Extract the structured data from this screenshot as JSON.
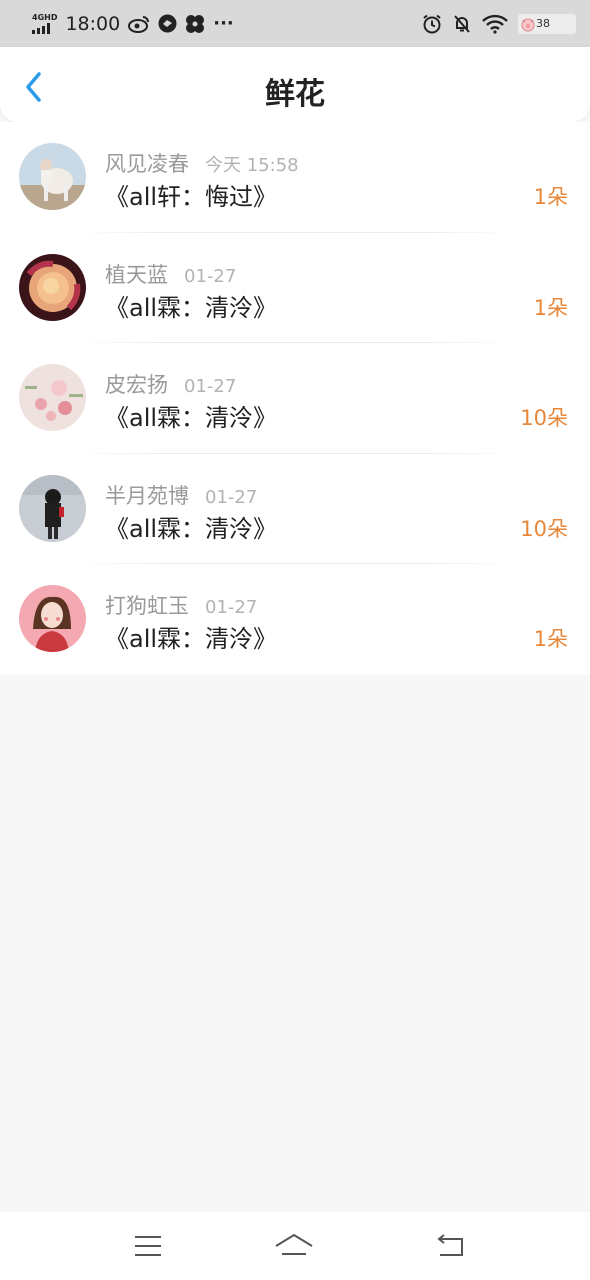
{
  "status_bar": {
    "network": "4GHD",
    "time": "18:00",
    "more": "···",
    "battery": "38"
  },
  "header": {
    "title": "鲜花"
  },
  "entries": [
    {
      "name": "风见凌春",
      "time": "今天 15:58",
      "work": "《all轩：悔过》",
      "count": "1朵"
    },
    {
      "name": "植天蓝",
      "time": "01-27",
      "work": "《all霖：清泠》",
      "count": "1朵"
    },
    {
      "name": "皮宏扬",
      "time": "01-27",
      "work": "《all霖：清泠》",
      "count": "10朵"
    },
    {
      "name": "半月苑博",
      "time": "01-27",
      "work": "《all霖：清泠》",
      "count": "10朵"
    },
    {
      "name": "打狗虹玉",
      "time": "01-27",
      "work": "《all霖：清泠》",
      "count": "1朵"
    }
  ],
  "colors": {
    "accent_blue": "#2a9be8",
    "count_orange": "#e8873a",
    "status_bar_bg": "#d9d9d9",
    "page_bg": "#f8f7f8"
  }
}
